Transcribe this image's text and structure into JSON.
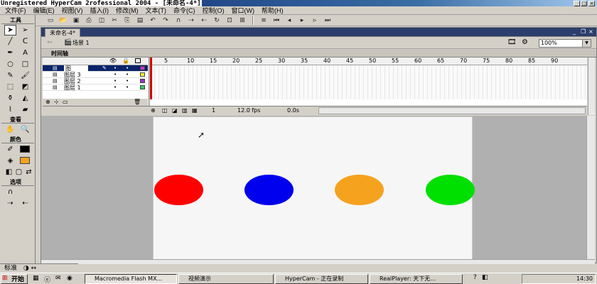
{
  "window": {
    "title": "Unregistered HyperCam 2",
    "overlay_title": "rofessional 2004 - [未命名-4*]"
  },
  "menu": [
    "文件(F)",
    "编辑(E)",
    "视图(V)",
    "插入(I)",
    "修改(M)",
    "文本(T)",
    "命令(C)",
    "控制(O)",
    "窗口(W)",
    "帮助(H)"
  ],
  "tools_panel": {
    "tools_heading": "工具",
    "view_heading": "查看",
    "colors_heading": "颜色",
    "options_heading": "选项"
  },
  "document": {
    "tab_label": "未命名-4*",
    "scene_label": "场景 1",
    "zoom": "100%"
  },
  "timeline": {
    "header": "时间轴",
    "layers": [
      {
        "name": "图",
        "active": true,
        "color": "#cc33cc"
      },
      {
        "name": "图层 3",
        "active": false,
        "color": "#ffff33"
      },
      {
        "name": "图层 2",
        "active": false,
        "color": "#9933cc"
      },
      {
        "name": "图层 1",
        "active": false,
        "color": "#33cc66"
      }
    ],
    "frame_ticks": [
      "5",
      "10",
      "15",
      "20",
      "25",
      "30",
      "35",
      "40",
      "45",
      "50",
      "55",
      "60",
      "65",
      "70",
      "75",
      "80",
      "85",
      "90"
    ],
    "current_frame": "1",
    "fps": "12.0 fps",
    "elapsed": "0.0s"
  },
  "stage": {
    "ellipses": [
      {
        "name": "red-ellipse",
        "color": "#ff0000"
      },
      {
        "name": "blue-ellipse",
        "color": "#0000ee"
      },
      {
        "name": "orange-ellipse",
        "color": "#f5a21e"
      },
      {
        "name": "green-ellipse",
        "color": "#00e000"
      }
    ]
  },
  "bottom_bar": {
    "label": "标准"
  },
  "taskbar": {
    "start_label": "开始",
    "tasks": [
      {
        "label": "Macromedia Flash MX..."
      },
      {
        "label": "视频演示"
      },
      {
        "label": "HyperCam - 正在录制"
      },
      {
        "label": "RealPlayer: 天下无..."
      }
    ],
    "clock": "14:30"
  }
}
